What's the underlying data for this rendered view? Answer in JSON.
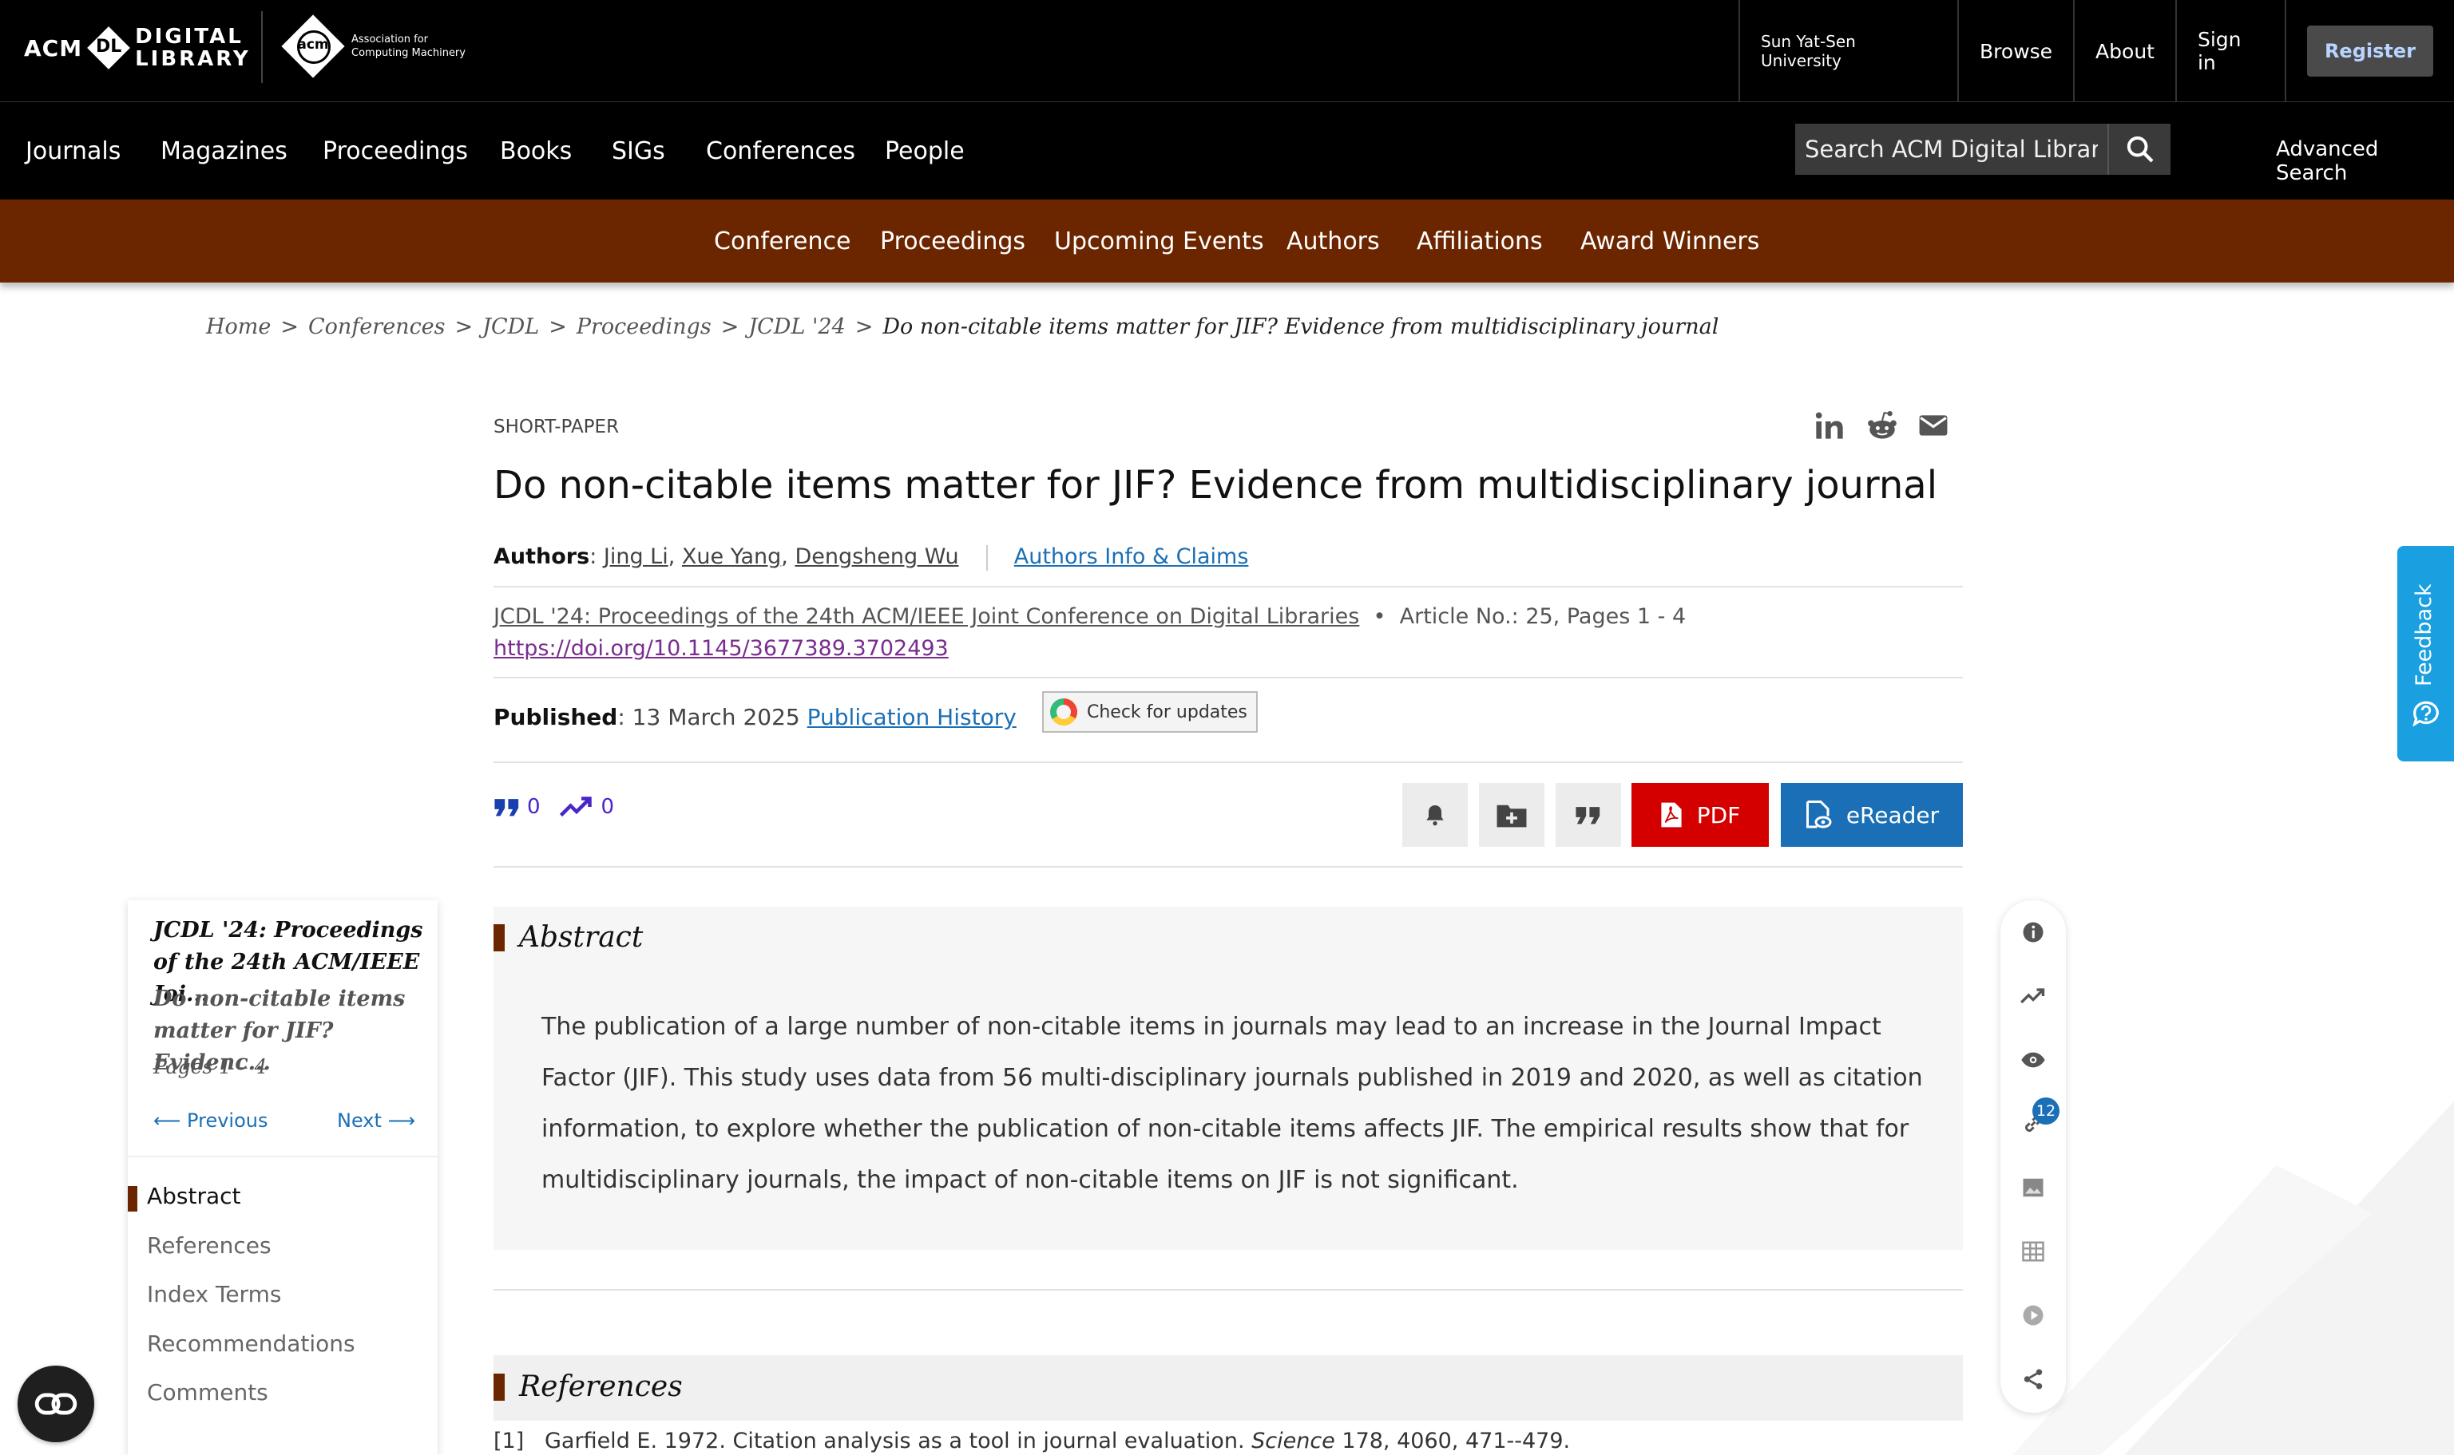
{
  "header": {
    "logo_dl": {
      "acm": "ACM",
      "dl": "DL",
      "line1": "DIGITAL",
      "line2": "LIBRARY"
    },
    "logo_acm": {
      "mark": "acm",
      "line1": "Association for",
      "line2": "Computing Machinery"
    },
    "institution": "Sun Yat-Sen University",
    "browse": "Browse",
    "about": "About",
    "sign_in": "Sign in",
    "register": "Register"
  },
  "mainnav": {
    "items": [
      "Journals",
      "Magazines",
      "Proceedings",
      "Books",
      "SIGs",
      "Conferences",
      "People"
    ],
    "search_placeholder": "Search ACM Digital Library",
    "advanced_search": "Advanced Search"
  },
  "confnav": {
    "items": [
      "Conference",
      "Proceedings",
      "Upcoming Events",
      "Authors",
      "Affiliations",
      "Award Winners"
    ]
  },
  "breadcrumb": {
    "items": [
      "Home",
      "Conferences",
      "JCDL",
      "Proceedings",
      "JCDL '24"
    ],
    "current": "Do non-citable items matter for JIF? Evidence from multidisciplinary journal"
  },
  "article": {
    "type": "SHORT-PAPER",
    "title": "Do non-citable items matter for JIF? Evidence from multidisciplinary journal",
    "authors_label": "Authors",
    "authors": [
      "Jing Li",
      "Xue Yang",
      "Dengsheng Wu"
    ],
    "authors_claims": "Authors Info & Claims",
    "proceedings": "JCDL '24: Proceedings of the 24th ACM/IEEE Joint Conference on Digital Libraries",
    "article_info": "Article No.: 25, Pages 1 - 4",
    "doi": "https://doi.org/10.1145/3677389.3702493",
    "published_label": "Published",
    "published_date": "13 March 2025",
    "publication_history": "Publication History",
    "check_updates": "Check for updates",
    "citations": "0",
    "downloads": "0",
    "pdf": "PDF",
    "ereader": "eReader"
  },
  "abstract": {
    "heading": "Abstract",
    "text": "The publication of a large number of non-citable items in journals may lead to an increase in the Journal Impact Factor (JIF). This study uses data from 56 multi-disciplinary journals published in 2019 and 2020, as well as citation information, to explore whether the publication of non-citable items affects JIF. The empirical results show that for multidisciplinary journals, the impact of non-citable items on JIF is not significant."
  },
  "references": {
    "heading": "References",
    "first": {
      "num": "[1]",
      "text": "Garfield E. 1972. Citation analysis as a tool in journal evaluation.",
      "journal": "Science",
      "rest": "178, 4060, 471--479."
    }
  },
  "sidebar": {
    "proceedings": "JCDL '24: Proceedings of the 24th ACM/IEEE Joi...",
    "paper": "Do non-citable items matter for JIF? Evidenc...",
    "pages": "Pages 1 – 4",
    "previous": "Previous",
    "next": "Next",
    "items": [
      "Abstract",
      "References",
      "Index Terms",
      "Recommendations",
      "Comments"
    ]
  },
  "tools": {
    "icons": [
      "info-icon",
      "trend-icon",
      "eye-icon",
      "link-icon",
      "image-icon",
      "table-icon",
      "play-icon",
      "share-icon"
    ],
    "badge": "12"
  },
  "feedback": "Feedback",
  "colors": {
    "brand_brown": "#6b2600",
    "pdf_red": "#d40000",
    "ereader_blue": "#1a6fb6",
    "feedback_blue": "#1aa0e0"
  }
}
